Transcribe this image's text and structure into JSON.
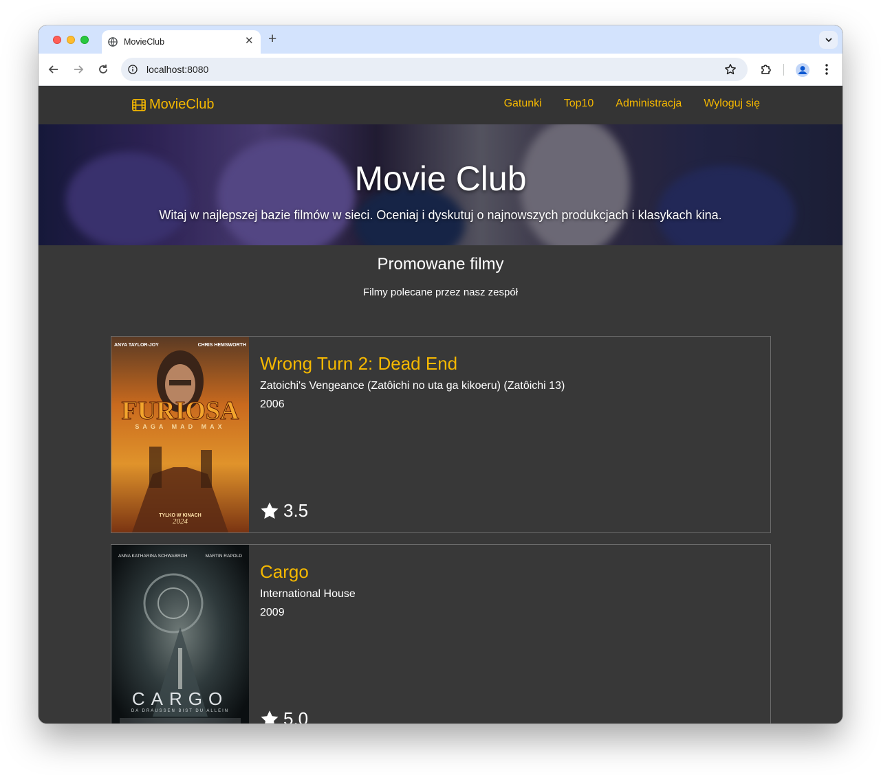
{
  "browser": {
    "tab_title": "MovieClub",
    "url": "localhost:8080"
  },
  "navbar": {
    "brand": "MovieClub",
    "links": [
      "Gatunki",
      "Top10",
      "Administracja",
      "Wyloguj się"
    ]
  },
  "hero": {
    "title": "Movie Club",
    "subtitle": "Witaj w najlepszej bazie filmów w sieci. Oceniaj i dyskutuj o najnowszych produkcjach i klasykach kina."
  },
  "promoted": {
    "title": "Promowane filmy",
    "subtitle": "Filmy polecane przez nasz zespół",
    "movies": [
      {
        "title": "Wrong Turn 2: Dead End",
        "original_title": "Zatoichi's Vengeance (Zatôichi no uta ga kikoeru) (Zatôichi 13)",
        "year": "2006",
        "rating": "3.5",
        "poster": {
          "top_left": "ANYA TAYLOR-JOY",
          "top_right": "CHRIS HEMSWORTH",
          "main": "FURIOSA",
          "saga": "SAGA MAD MAX",
          "footer": "TYLKO W KINACH",
          "date": "2024"
        }
      },
      {
        "title": "Cargo",
        "original_title": "International House",
        "year": "2009",
        "rating": "5.0",
        "poster": {
          "top_left": "ANNA KATHARINA SCHWABROH",
          "top_right": "MARTIN RAPOLD",
          "main": "CARGO",
          "tagline": "DA DRAUSSEN BIST DU ALLEIN"
        }
      }
    ]
  },
  "colors": {
    "accent": "#f5b800",
    "background": "#383838",
    "navbar": "#343434"
  }
}
